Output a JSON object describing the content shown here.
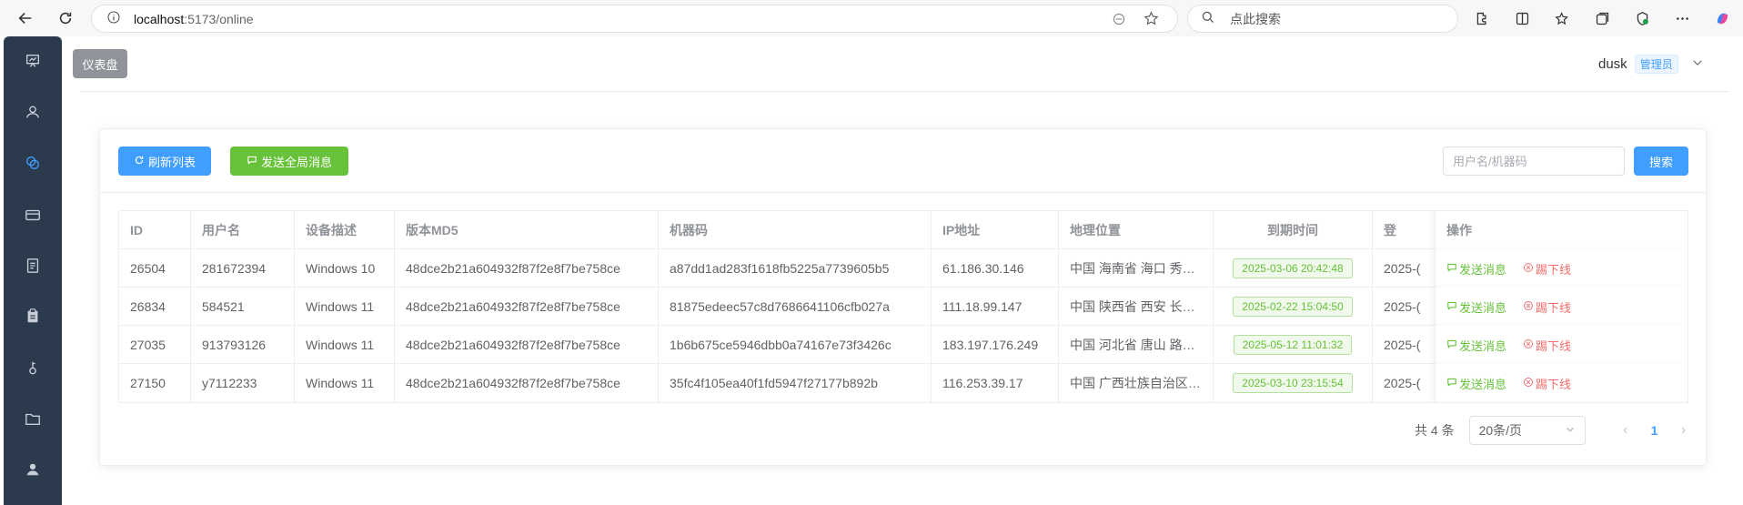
{
  "browser": {
    "url_host": "localhost",
    "url_path": ":5173/online",
    "search_placeholder": "点此搜索"
  },
  "sidebar": {
    "tooltip": "仪表盘",
    "items": [
      "dashboard-icon",
      "user-icon",
      "chat-icon",
      "card-icon",
      "document-icon",
      "clipboard-icon",
      "key-icon",
      "folder-icon",
      "profile-icon"
    ]
  },
  "header": {
    "username": "dusk",
    "role": "管理员"
  },
  "toolbar": {
    "refresh_label": "刷新列表",
    "broadcast_label": "发送全局消息",
    "search_placeholder": "用户名/机器码",
    "search_label": "搜索"
  },
  "table": {
    "columns": {
      "id": "ID",
      "user": "用户名",
      "device": "设备描述",
      "md5": "版本MD5",
      "machine": "机器码",
      "ip": "IP地址",
      "geo": "地理位置",
      "expire": "到期时间",
      "login": "登",
      "ops": "操作"
    },
    "rows": [
      {
        "id": "26504",
        "user": "281672394",
        "device": "Windows 10",
        "md5": "48dce2b21a604932f87f2e8f7be758ce",
        "machine": "a87dd1ad283f1618fb5225a7739605b5",
        "ip": "61.186.30.146",
        "geo": "中国 海南省 海口 秀…",
        "expire": "2025-03-06 20:42:48",
        "login": "2025-(",
        "send": "发送消息",
        "kick": "踢下线"
      },
      {
        "id": "26834",
        "user": "584521",
        "device": "Windows 11",
        "md5": "48dce2b21a604932f87f2e8f7be758ce",
        "machine": "81875edeec57c8d7686641106cfb027a",
        "ip": "111.18.99.147",
        "geo": "中国 陕西省 西安 长…",
        "expire": "2025-02-22 15:04:50",
        "login": "2025-(",
        "send": "发送消息",
        "kick": "踢下线"
      },
      {
        "id": "27035",
        "user": "913793126",
        "device": "Windows 11",
        "md5": "48dce2b21a604932f87f2e8f7be758ce",
        "machine": "1b6b675ce5946dbb0a74167e73f3426c",
        "ip": "183.197.176.249",
        "geo": "中国 河北省 唐山 路…",
        "expire": "2025-05-12 11:01:32",
        "login": "2025-(",
        "send": "发送消息",
        "kick": "踢下线"
      },
      {
        "id": "27150",
        "user": "y7112233",
        "device": "Windows 11",
        "md5": "48dce2b21a604932f87f2e8f7be758ce",
        "machine": "35fc4f105ea40f1fd5947f27177b892b",
        "ip": "116.253.39.17",
        "geo": "中国 广西壮族自治区…",
        "expire": "2025-03-10 23:15:54",
        "login": "2025-(",
        "send": "发送消息",
        "kick": "踢下线"
      }
    ]
  },
  "pagination": {
    "total": "共 4 条",
    "page_size": "20条/页",
    "current": "1"
  }
}
